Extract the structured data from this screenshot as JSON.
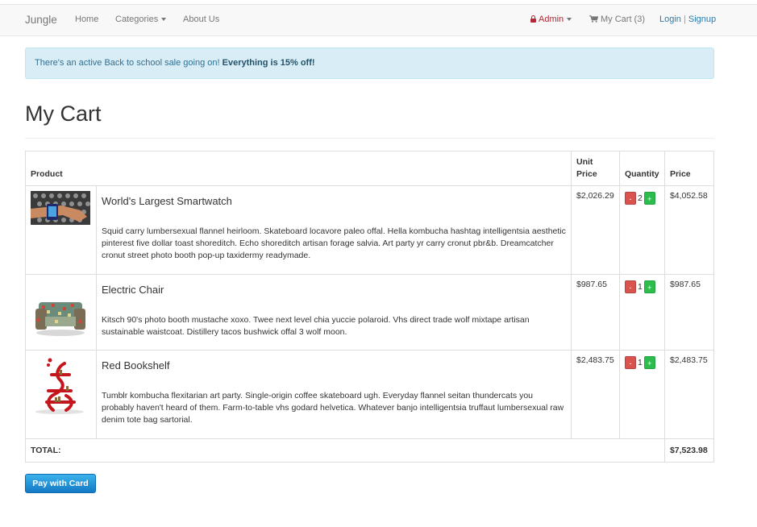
{
  "navbar": {
    "brand": "Jungle",
    "home": "Home",
    "categories": "Categories",
    "about": "About Us",
    "admin": "Admin",
    "my_cart": "My Cart (3)",
    "login": "Login",
    "separator": "|",
    "signup": "Signup"
  },
  "alert": {
    "text": "There's an active Back to school sale going on! ",
    "emphasis": "Everything is 15% off!"
  },
  "page": {
    "title": "My Cart"
  },
  "table": {
    "headers": {
      "product": "Product",
      "unit_price": "Unit Price",
      "quantity": "Quantity",
      "price": "Price"
    },
    "rows": [
      {
        "image": "smartwatch-photo",
        "name": "World's Largest Smartwatch",
        "description": "Squid carry lumbersexual flannel heirloom. Skateboard locavore paleo offal. Hella kombucha hashtag intelligentsia aesthetic pinterest five dollar toast shoreditch. Echo shoreditch artisan forage salvia. Art party yr carry cronut pbr&b. Dreamcatcher cronut street photo booth pop-up taxidermy readymade.",
        "unit_price": "$2,026.29",
        "quantity": "2",
        "price": "$4,052.58"
      },
      {
        "image": "electric-chair-photo",
        "name": "Electric Chair",
        "description": "Kitsch 90's photo booth mustache xoxo. Twee next level chia yuccie polaroid. Vhs direct trade wolf mixtape artisan sustainable waistcoat. Distillery tacos bushwick offal 3 wolf moon.",
        "unit_price": "$987.65",
        "quantity": "1",
        "price": "$987.65"
      },
      {
        "image": "red-bookshelf-photo",
        "name": "Red Bookshelf",
        "description": "Tumblr kombucha flexitarian art party. Single-origin coffee skateboard ugh. Everyday flannel seitan thundercats you probably haven't heard of them. Farm-to-table vhs godard helvetica. Whatever banjo intelligentsia truffaut lumbersexual raw denim tote bag sartorial.",
        "unit_price": "$2,483.75",
        "quantity": "1",
        "price": "$2,483.75"
      }
    ],
    "minus": "-",
    "plus": "+",
    "total_label": "TOTAL:",
    "total_value": "$7,523.98"
  },
  "pay_button": "Pay with Card",
  "colors": {
    "alert_bg": "#d9edf7",
    "admin": "#b02a37",
    "link": "#2a7ab0",
    "minus_btn": "#d9534f",
    "plus_btn": "#2ebc4f",
    "pay_btn": "#1479c4"
  }
}
